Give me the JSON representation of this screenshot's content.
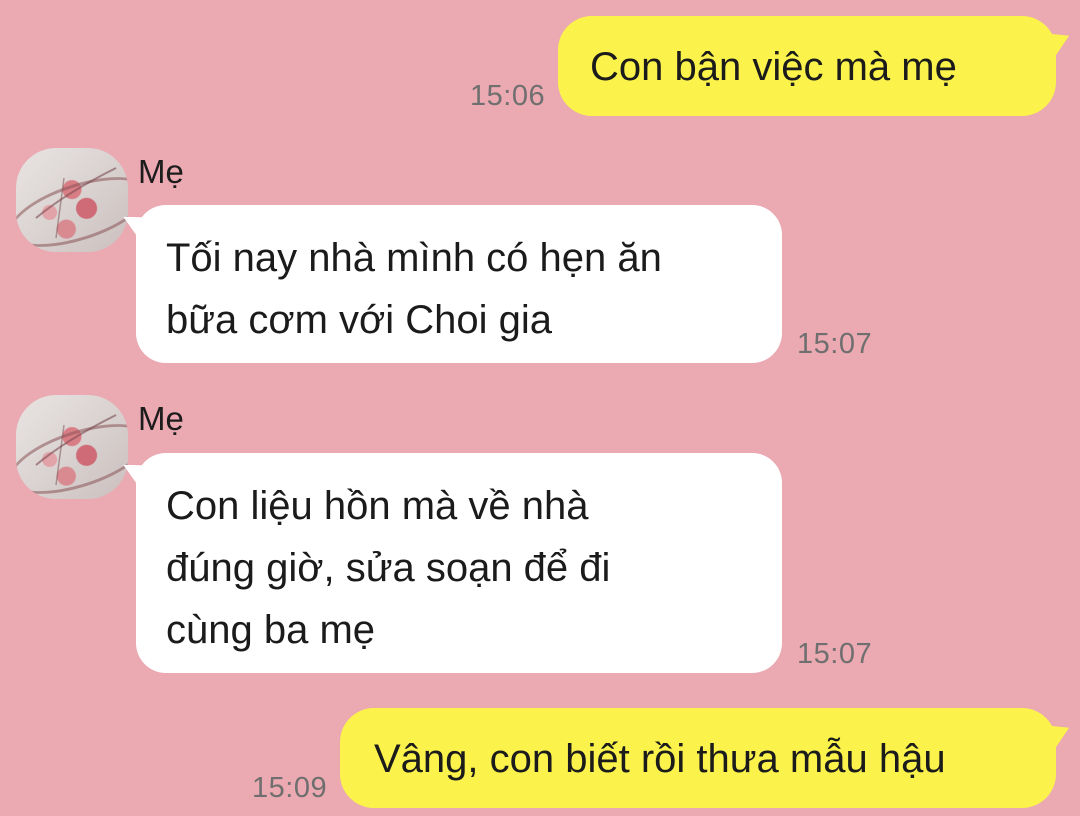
{
  "messages": [
    {
      "direction": "outgoing",
      "text": "Con bận việc mà mẹ",
      "time": "15:06"
    },
    {
      "direction": "incoming",
      "sender": "Mẹ",
      "lines": [
        "Tối nay nhà mình có hẹn ăn",
        "bữa cơm với Choi gia"
      ],
      "time": "15:07"
    },
    {
      "direction": "incoming",
      "sender": "Mẹ",
      "lines": [
        "Con liệu hồn mà về nhà",
        "đúng giờ, sửa soạn để đi",
        "cùng ba mẹ"
      ],
      "time": "15:07"
    },
    {
      "direction": "outgoing",
      "text": "Vâng, con biết rồi thưa mẫu hậu",
      "time": "15:09"
    }
  ],
  "colors": {
    "background": "#eba9b1",
    "outgoing_bubble": "#fbf34b",
    "incoming_bubble": "#ffffff",
    "timestamp": "#6f6f6f"
  },
  "icons": {
    "avatar": "flower-photo-avatar"
  }
}
